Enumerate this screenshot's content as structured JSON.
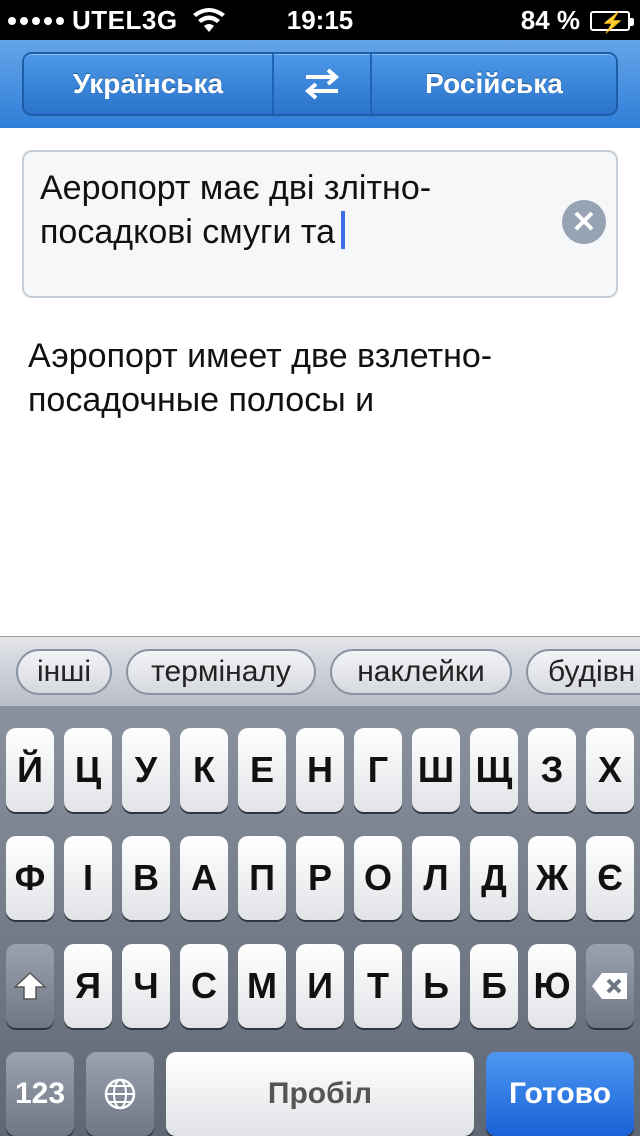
{
  "status_bar": {
    "carrier": "UTEL3G",
    "time": "19:15",
    "battery": "84 %"
  },
  "languages": {
    "source": "Українська",
    "swap_icon": "swap-arrows-icon",
    "target": "Російська"
  },
  "input": {
    "line1": "Аеропорт має дві злітно-",
    "line2": "посадкові смуги та"
  },
  "output": {
    "line1": "Аэропорт имеет две взлетно-",
    "line2": "посадочные полосы и"
  },
  "suggestions": [
    "інші",
    "терміналу",
    "наклейки",
    "будівн"
  ],
  "keyboard": {
    "row1": [
      "Й",
      "Ц",
      "У",
      "К",
      "Е",
      "Н",
      "Г",
      "Ш",
      "Щ",
      "З",
      "Х"
    ],
    "row2": [
      "Ф",
      "І",
      "В",
      "А",
      "П",
      "Р",
      "О",
      "Л",
      "Д",
      "Ж",
      "Є"
    ],
    "row3": [
      "Я",
      "Ч",
      "С",
      "М",
      "И",
      "Т",
      "Ь",
      "Б",
      "Ю"
    ],
    "numbers_label": "123",
    "space_label": "Пробіл",
    "done_label": "Готово"
  },
  "colors": {
    "header_blue": "#2f7ed8",
    "done_blue": "#1a62d6",
    "cursor": "#3c6ee6"
  }
}
